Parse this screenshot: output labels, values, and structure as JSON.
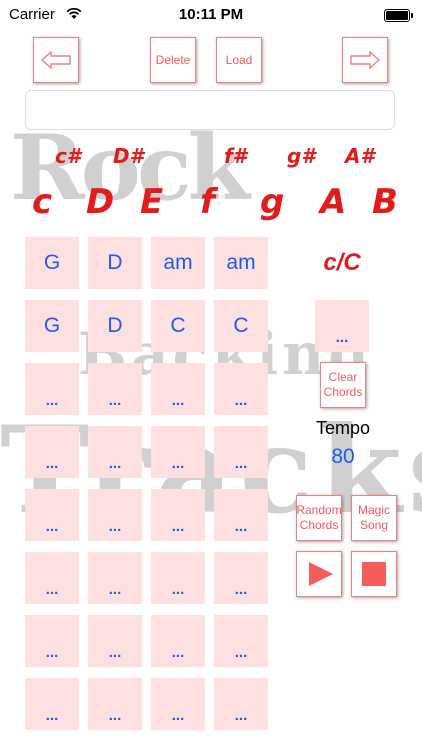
{
  "status_bar": {
    "carrier": "Carrier",
    "time": "10:11 PM"
  },
  "toolbar": {
    "delete_label": "Delete",
    "load_label": "Load",
    "back_icon": "left-arrow-icon",
    "forward_icon": "right-arrow-icon"
  },
  "song_name": {
    "value": "",
    "placeholder": ""
  },
  "keys": {
    "sharps": [
      "c#",
      "D#",
      "f#",
      "g#",
      "A#"
    ],
    "naturals": [
      "c",
      "D",
      "E",
      "f",
      "g",
      "A",
      "B"
    ]
  },
  "chord_grid": {
    "row1": [
      "G",
      "D",
      "am",
      "am"
    ],
    "row2": [
      "G",
      "D",
      "C",
      "C"
    ],
    "empty": "..."
  },
  "current_chord": "c/C",
  "side_pad": "...",
  "clear_chords": {
    "line1": "Clear",
    "line2": "Chords"
  },
  "tempo": {
    "label": "Tempo",
    "value": "80"
  },
  "random_chords": {
    "line1": "Random",
    "line2": "Chords"
  },
  "magic_song": {
    "line1": "Magic",
    "line2": "Song"
  },
  "colors": {
    "accent_red": "#e41b1b",
    "pad_pink": "#ffe0e0",
    "chord_blue": "#1a5cf0"
  }
}
